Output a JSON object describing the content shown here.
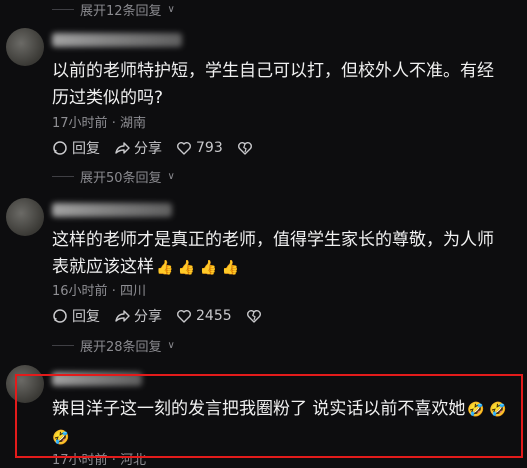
{
  "expand": {
    "top": "展开12条回复",
    "mid": "展开50条回复",
    "low": "展开28条回复"
  },
  "comments": [
    {
      "text": "以前的老师特护短，学生自己可以打，但校外人不准。有经历过类似的吗?",
      "time": "17小时前",
      "location": "湖南",
      "reply_label": "回复",
      "share_label": "分享",
      "likes": "793"
    },
    {
      "text": "这样的老师才是真正的老师，值得学生家长的尊敬，为人师表就应该这样",
      "emojis": "👍 👍 👍 👍",
      "time": "16小时前",
      "location": "四川",
      "reply_label": "回复",
      "share_label": "分享",
      "likes": "2455"
    },
    {
      "text": "辣目洋子这一刻的发言把我圈粉了   说实话以前不喜欢她",
      "emojis": "🤣 🤣 🤣",
      "time": "17小时前",
      "location": "河北"
    }
  ]
}
